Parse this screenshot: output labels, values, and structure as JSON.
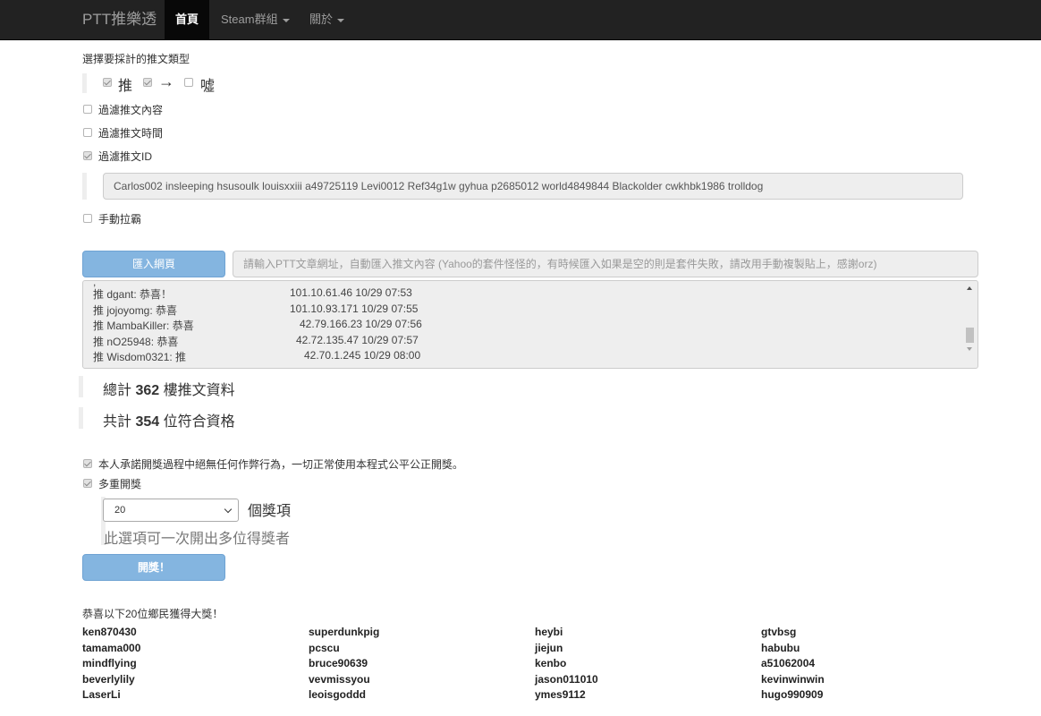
{
  "navbar": {
    "brand": "PTT推樂透",
    "home": "首頁",
    "steam": "Steam群組",
    "about": "關於"
  },
  "push_type": {
    "heading": "選擇要採計的推文類型",
    "push": {
      "label": "推",
      "checked": true
    },
    "arrow": {
      "label": "→",
      "checked": true
    },
    "boo": {
      "label": "噓",
      "checked": false
    }
  },
  "filters": {
    "content": {
      "label": "過濾推文內容",
      "checked": false
    },
    "time": {
      "label": "過濾推文時間",
      "checked": false
    },
    "id": {
      "label": "過濾推文ID",
      "checked": true
    },
    "id_value": "Carlos002 insleeping hsusoulk louisxxiii a49725119 Levi0012 Ref34g1w gyhua p2685012 world4849844 Blackolder cwkhbk1986 trolldog",
    "manual": {
      "label": "手動拉霸",
      "checked": false
    }
  },
  "import": {
    "button": "匯入網頁",
    "url_placeholder": "請輸入PTT文章網址，自動匯入推文內容 (Yahoo的套件怪怪的，有時候匯入如果是空的則是套件失敗，請改用手動複製貼上，感謝orz)"
  },
  "comments": [
    {
      "text": "推 dgant: 恭喜！",
      "meta": "101.10.61.46 10/29 07:53"
    },
    {
      "text": "推 jojoyomg: 恭喜",
      "meta": "101.10.93.171 10/29 07:55"
    },
    {
      "text": "推 MambaKiller: 恭喜",
      "meta": "42.79.166.23 10/29 07:56"
    },
    {
      "text": "推 nO25948: 恭喜",
      "meta": "42.72.135.47 10/29 07:57"
    },
    {
      "text": "推 Wisdom0321: 推",
      "meta": "42.70.1.245 10/29 08:00"
    }
  ],
  "stats": {
    "total_prefix": "總計",
    "total_count": "362",
    "total_suffix": "樓推文資料",
    "eligible_prefix": "共計",
    "eligible_count": "354",
    "eligible_suffix": "位符合資格"
  },
  "draw": {
    "pledge": {
      "label": "本人承諾開獎過程中絕無任何作弊行為，一切正常使用本程式公平公正開獎。",
      "checked": true
    },
    "multi": {
      "label": "多重開獎",
      "checked": true
    },
    "prize_count": "20",
    "prize_unit": "個獎項",
    "hint": "此選項可一次開出多位得獎者",
    "button": "開獎！"
  },
  "result": {
    "heading": "恭喜以下20位鄉民獲得大獎！",
    "winners": [
      [
        "ken870430",
        "superdunkpig",
        "heybi",
        "gtvbsg"
      ],
      [
        "tamama000",
        "pcscu",
        "jiejun",
        "habubu"
      ],
      [
        "mindflying",
        "bruce90639",
        "kenbo",
        "a51062004"
      ],
      [
        "beverlylily",
        "vevmissyou",
        "jason011010",
        "kevinwinwin"
      ],
      [
        "LaserLi",
        "leoisgoddd",
        "ymes9112",
        "hugo990909"
      ]
    ]
  }
}
